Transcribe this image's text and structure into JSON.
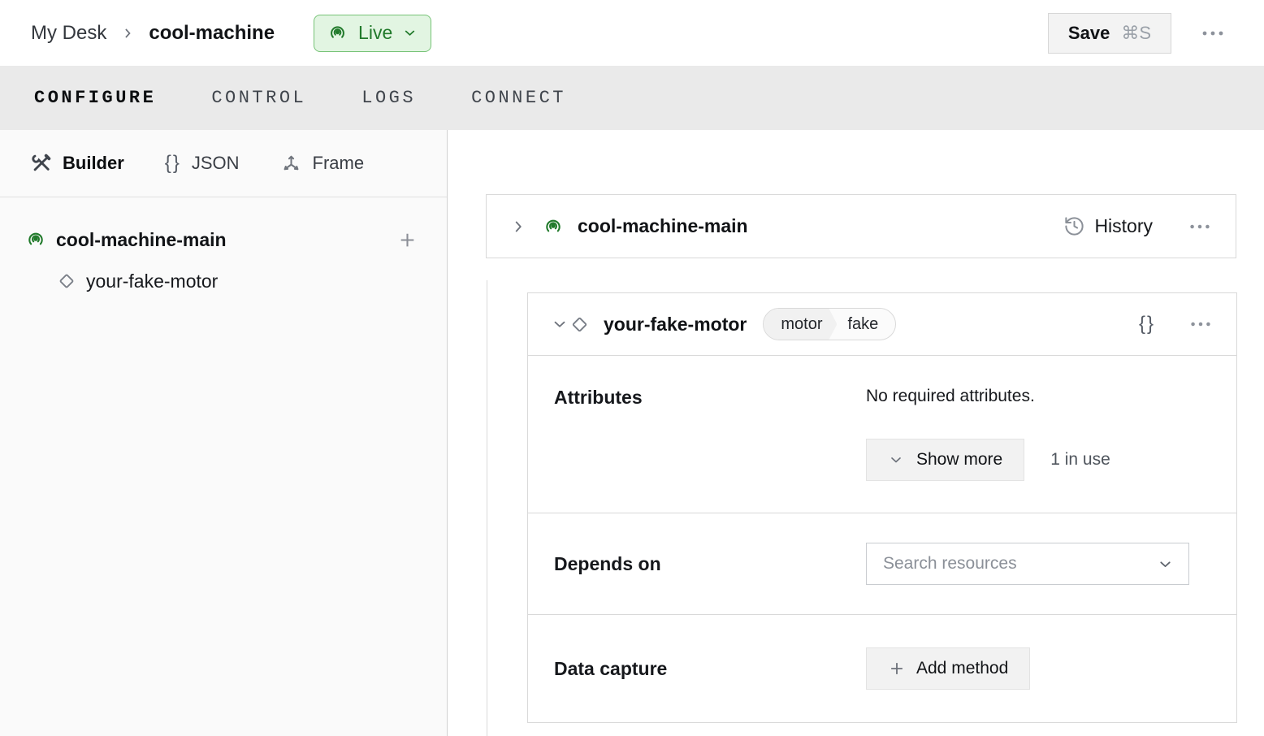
{
  "topbar": {
    "breadcrumb": {
      "parent": "My Desk",
      "current": "cool-machine"
    },
    "live_button": {
      "label": "Live"
    },
    "save_button": {
      "label": "Save",
      "shortcut": "⌘S"
    }
  },
  "nav": {
    "tabs": [
      {
        "label": "CONFIGURE",
        "active": true
      },
      {
        "label": "CONTROL",
        "active": false
      },
      {
        "label": "LOGS",
        "active": false
      },
      {
        "label": "CONNECT",
        "active": false
      }
    ]
  },
  "sidebar": {
    "view_tabs": [
      {
        "label": "Builder",
        "icon": "tools-icon",
        "active": true
      },
      {
        "label": "JSON",
        "icon": "braces-icon",
        "active": false
      },
      {
        "label": "Frame",
        "icon": "frame-axes-icon",
        "active": false
      }
    ],
    "tree": {
      "root": {
        "label": "cool-machine-main"
      },
      "children": [
        {
          "label": "your-fake-motor"
        }
      ]
    }
  },
  "main": {
    "machine_card": {
      "title": "cool-machine-main",
      "history_label": "History"
    },
    "component_card": {
      "title": "your-fake-motor",
      "type_tag": "motor",
      "model_tag": "fake",
      "attributes": {
        "label": "Attributes",
        "message": "No required attributes.",
        "show_more_label": "Show more",
        "usage": "1 in use"
      },
      "depends_on": {
        "label": "Depends on",
        "placeholder": "Search resources"
      },
      "data_capture": {
        "label": "Data capture",
        "add_method_label": "Add method"
      }
    }
  },
  "icons": {
    "braces": "{}"
  },
  "colors": {
    "accent_green": "#217a2b",
    "live_bg": "#e2f5e2",
    "live_border": "#77c377",
    "tabbar_bg": "#eaeaea",
    "card_border": "#d9d9d9"
  }
}
